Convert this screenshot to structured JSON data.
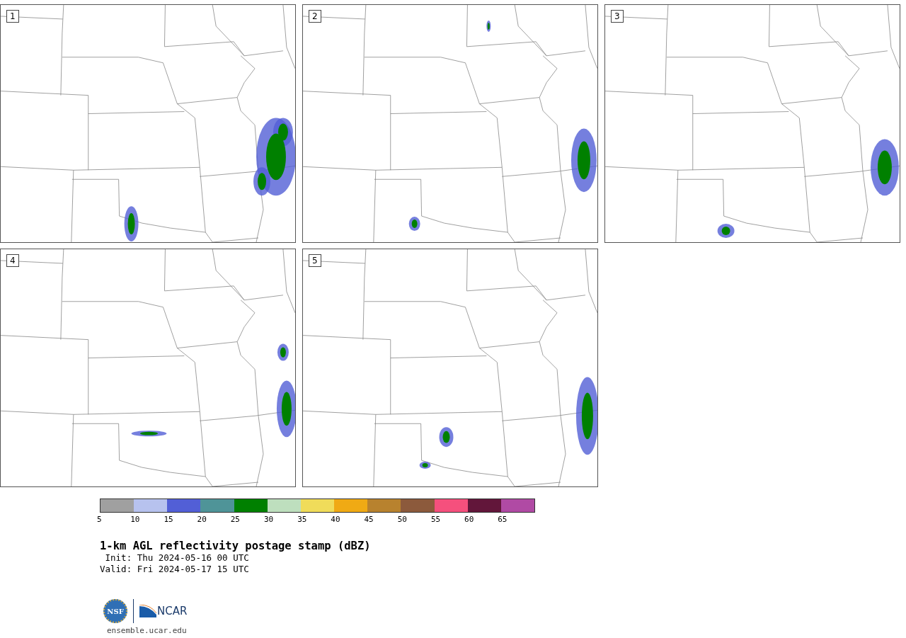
{
  "panels": [
    {
      "label": "1"
    },
    {
      "label": "2"
    },
    {
      "label": "3"
    },
    {
      "label": "4"
    },
    {
      "label": "5"
    }
  ],
  "colorbar": {
    "segments": [
      {
        "color": "#a0a0a0"
      },
      {
        "color": "#b7c2ee"
      },
      {
        "color": "#525fd6"
      },
      {
        "color": "#4f9498"
      },
      {
        "color": "#008000"
      },
      {
        "color": "#bedfbe"
      },
      {
        "color": "#f0dc5a"
      },
      {
        "color": "#f0aa14"
      },
      {
        "color": "#b8822e"
      },
      {
        "color": "#8c5a3c"
      },
      {
        "color": "#f5507d"
      },
      {
        "color": "#62163a"
      },
      {
        "color": "#b04aa4"
      }
    ],
    "ticks": [
      "5",
      "10",
      "15",
      "20",
      "25",
      "30",
      "35",
      "40",
      "45",
      "50",
      "55",
      "60",
      "65"
    ]
  },
  "title": "1-km AGL reflectivity postage stamp (dBZ)",
  "init": " Init: Thu 2024-05-16 00 UTC",
  "valid": "Valid: Fri 2024-05-17 15 UTC",
  "logos": {
    "nsf": "NSF",
    "ncar": "NCAR"
  },
  "url": "ensemble.ucar.edu"
}
